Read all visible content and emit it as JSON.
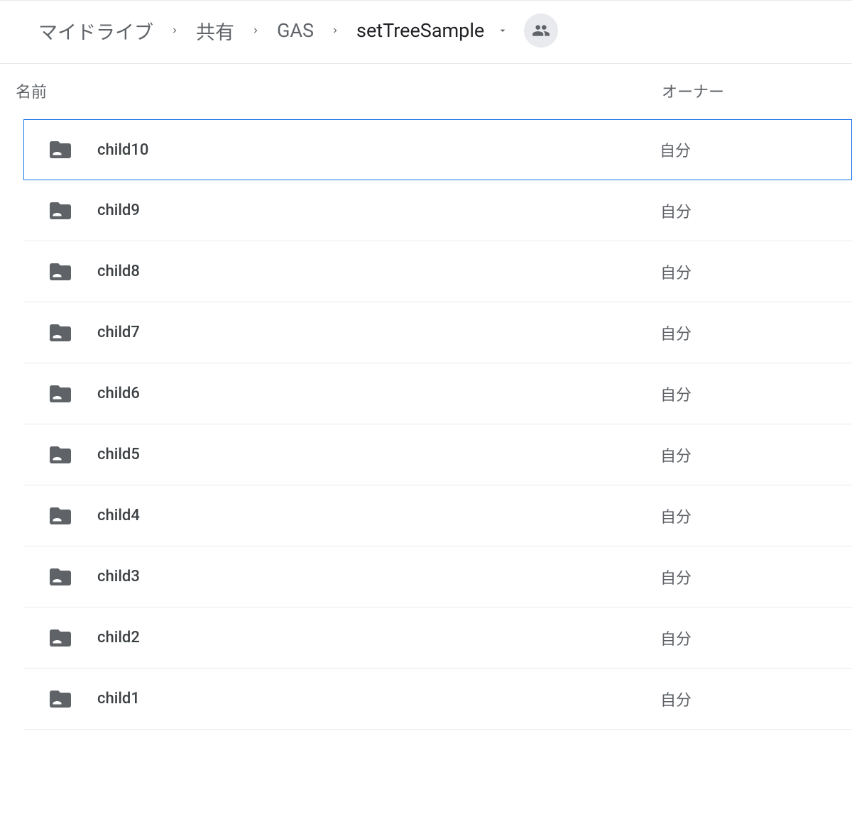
{
  "breadcrumb": {
    "items": [
      {
        "label": "マイドライブ"
      },
      {
        "label": "共有"
      },
      {
        "label": "GAS"
      },
      {
        "label": "setTreeSample",
        "current": true
      }
    ]
  },
  "headers": {
    "name": "名前",
    "owner": "オーナー"
  },
  "rows": [
    {
      "name": "child10",
      "owner": "自分",
      "selected": true
    },
    {
      "name": "child9",
      "owner": "自分",
      "selected": false
    },
    {
      "name": "child8",
      "owner": "自分",
      "selected": false
    },
    {
      "name": "child7",
      "owner": "自分",
      "selected": false
    },
    {
      "name": "child6",
      "owner": "自分",
      "selected": false
    },
    {
      "name": "child5",
      "owner": "自分",
      "selected": false
    },
    {
      "name": "child4",
      "owner": "自分",
      "selected": false
    },
    {
      "name": "child3",
      "owner": "自分",
      "selected": false
    },
    {
      "name": "child2",
      "owner": "自分",
      "selected": false
    },
    {
      "name": "child1",
      "owner": "自分",
      "selected": false
    }
  ]
}
